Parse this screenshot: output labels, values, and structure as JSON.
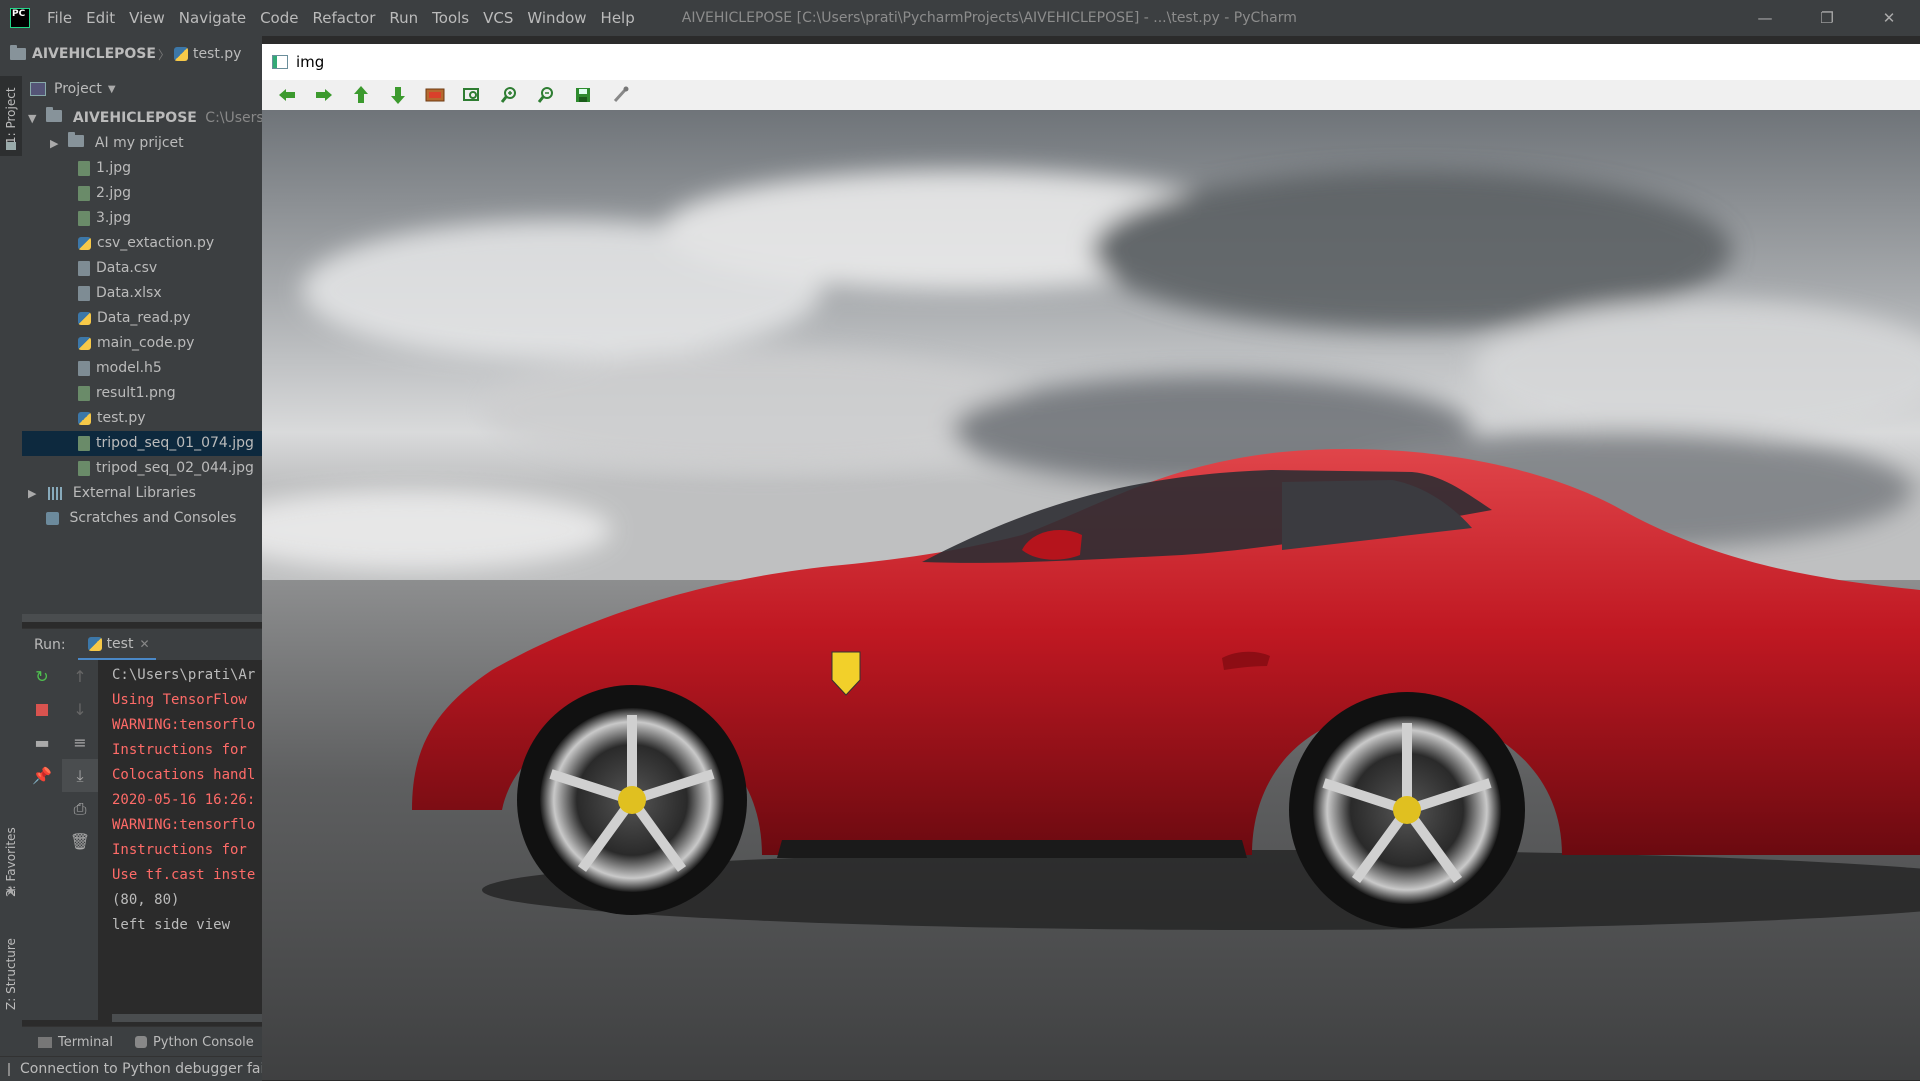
{
  "window": {
    "menu": [
      "File",
      "Edit",
      "View",
      "Navigate",
      "Code",
      "Refactor",
      "Run",
      "Tools",
      "VCS",
      "Window",
      "Help"
    ],
    "title": "AIVEHICLEPOSE [C:\\Users\\prati\\PycharmProjects\\AIVEHICLEPOSE] - ...\\test.py - PyCharm",
    "controls": {
      "minimize": "—",
      "restore": "❐",
      "close": "✕"
    }
  },
  "navbar": {
    "project": "AIVEHICLEPOSE",
    "separator": "〉",
    "file": "test.py"
  },
  "sidebar_tabs": {
    "project": "1: Project",
    "favorites": "2: Favorites",
    "structure": "Z: Structure"
  },
  "project_panel": {
    "title": "Project",
    "root": {
      "name": "AIVEHICLEPOSE",
      "path": "C:\\Users\\"
    },
    "items": [
      {
        "name": "AI my prijcet",
        "kind": "folder"
      },
      {
        "name": "1.jpg",
        "kind": "img"
      },
      {
        "name": "2.jpg",
        "kind": "img"
      },
      {
        "name": "3.jpg",
        "kind": "img"
      },
      {
        "name": "csv_extaction.py",
        "kind": "py"
      },
      {
        "name": "Data.csv",
        "kind": "doc"
      },
      {
        "name": "Data.xlsx",
        "kind": "doc"
      },
      {
        "name": "Data_read.py",
        "kind": "py"
      },
      {
        "name": "main_code.py",
        "kind": "py"
      },
      {
        "name": "model.h5",
        "kind": "doc"
      },
      {
        "name": "result1.png",
        "kind": "img"
      },
      {
        "name": "test.py",
        "kind": "py"
      },
      {
        "name": "tripod_seq_01_074.jpg",
        "kind": "img",
        "selected": true
      },
      {
        "name": "tripod_seq_02_044.jpg",
        "kind": "img"
      }
    ],
    "external": "External Libraries",
    "scratches": "Scratches and Consoles"
  },
  "run": {
    "label": "Run:",
    "tab": "test",
    "lines": [
      {
        "text": "C:\\Users\\prati\\Ar",
        "type": "out"
      },
      {
        "text": "Using TensorFlow",
        "type": "err"
      },
      {
        "text": "WARNING:tensorflo",
        "type": "err"
      },
      {
        "text": "Instructions for",
        "type": "err"
      },
      {
        "text": "Colocations handl",
        "type": "err"
      },
      {
        "text": "2020-05-16 16:26:",
        "type": "err"
      },
      {
        "text": "WARNING:tensorflo",
        "type": "err"
      },
      {
        "text": "Instructions for",
        "type": "err"
      },
      {
        "text": "Use tf.cast inste",
        "type": "err"
      },
      {
        "text": "(80, 80)",
        "type": "out"
      },
      {
        "text": "left side view",
        "type": "out"
      }
    ]
  },
  "bottom_tabs": {
    "terminal": "Terminal",
    "python_console": "Python Console"
  },
  "status": "Connection to Python debugger fail",
  "image_window": {
    "title": "img",
    "toolbar": [
      "arrow-left-icon",
      "arrow-right-icon",
      "arrow-up-icon",
      "arrow-down-icon",
      "image-icon",
      "zoom-region-icon",
      "zoom-in-icon",
      "zoom-out-icon",
      "save-icon",
      "brush-icon"
    ]
  },
  "colors": {
    "accent": "#4a88c7",
    "error": "#ff6b68",
    "selection": "#0d293e",
    "car_red": "#c8161e",
    "toolbar_green": "#3c9a2e"
  }
}
